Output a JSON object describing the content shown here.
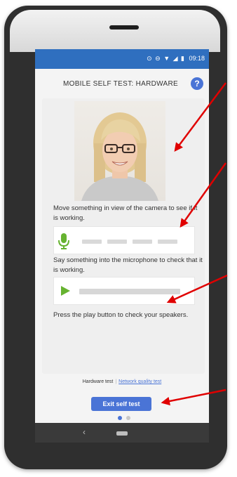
{
  "status_bar": {
    "icons": "⊙ ⊖ ▼ ◢ ▮",
    "time": "09:18"
  },
  "header": {
    "title": "MOBILE SELF TEST: HARDWARE",
    "help_label": "?"
  },
  "camera": {
    "caption": "Move something in view of the camera to see if it is working."
  },
  "microphone": {
    "caption": "Say something into the microphone to check that it is working."
  },
  "speakers": {
    "caption": "Press the play button to check your speakers."
  },
  "footer": {
    "hardware_test": "Hardware test",
    "separator": "|",
    "network_test": "Network quality test"
  },
  "exit_button": {
    "label": "Exit self test"
  },
  "navbar": {
    "back_symbol": "‹"
  },
  "colors": {
    "brand_blue": "#2f6fbf",
    "button_blue": "#4a74d6",
    "mic_green": "#66b330",
    "arrow_red": "#e00000"
  },
  "icons": {
    "help": "question-icon",
    "microphone": "microphone-icon",
    "play": "play-icon"
  }
}
